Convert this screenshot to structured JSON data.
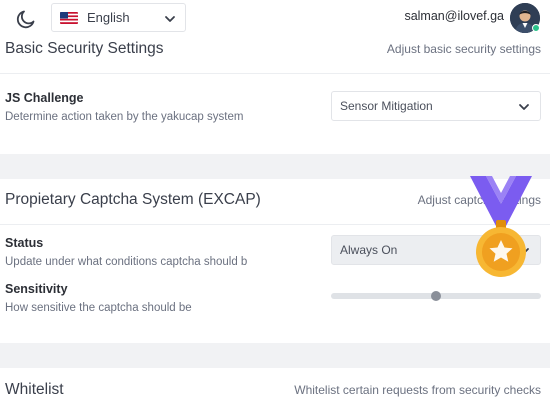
{
  "topbar": {
    "theme_icon": "moon-icon",
    "language": {
      "label": "English",
      "flag_icon": "us-flag-icon"
    },
    "user_email": "salman@ilovef.ga",
    "avatar_icon": "user-avatar"
  },
  "basic_security": {
    "title": "Basic Security Settings",
    "subtitle": "Adjust basic security settings",
    "js_challenge": {
      "title": "JS Challenge",
      "description": "Determine action taken by the yakucap system",
      "value": "Sensor Mitigation"
    }
  },
  "excap": {
    "title": "Propietary Captcha System (EXCAP)",
    "subtitle": "Adjust captcha settings",
    "status": {
      "title": "Status",
      "description": "Update under what conditions captcha should b",
      "value": "Always On"
    },
    "sensitivity": {
      "title": "Sensitivity",
      "description": "How sensitive the captcha should be",
      "level": 0.5
    }
  },
  "whitelist": {
    "title": "Whitelist",
    "subtitle": "Whitelist certain requests from security checks"
  },
  "badge": {
    "icon": "medal-star-icon"
  },
  "colors": {
    "accent": "#7b5cf0",
    "medal": "#f5a623",
    "online": "#2bc28b"
  }
}
